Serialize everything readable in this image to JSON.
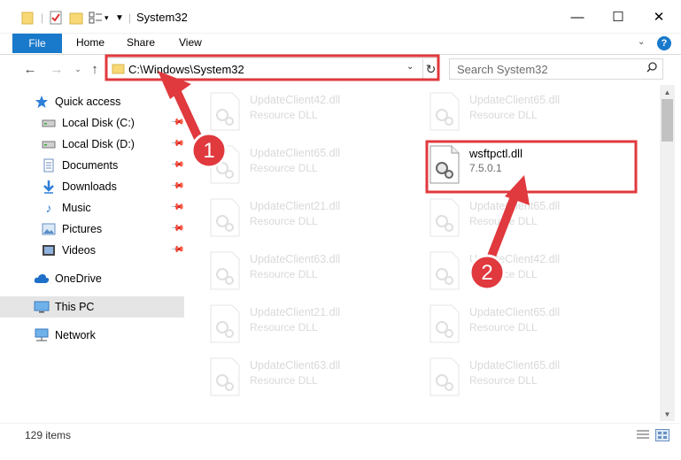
{
  "window": {
    "title": "System32",
    "minimize": "—",
    "maximize": "☐",
    "close": "✕"
  },
  "ribbon": {
    "file": "File",
    "home": "Home",
    "share": "Share",
    "view": "View",
    "help": "?"
  },
  "nav": {
    "address": "C:\\Windows\\System32",
    "search_placeholder": "Search System32"
  },
  "sidebar": {
    "items": [
      {
        "label": "Quick access",
        "icon": "star-icon"
      },
      {
        "label": "Local Disk (C:)",
        "icon": "drive-icon",
        "pinned": true
      },
      {
        "label": "Local Disk (D:)",
        "icon": "drive-icon",
        "pinned": true
      },
      {
        "label": "Documents",
        "icon": "documents-icon",
        "pinned": true
      },
      {
        "label": "Downloads",
        "icon": "download-icon",
        "pinned": true
      },
      {
        "label": "Music",
        "icon": "music-icon",
        "pinned": true
      },
      {
        "label": "Pictures",
        "icon": "pictures-icon",
        "pinned": true
      },
      {
        "label": "Videos",
        "icon": "videos-icon",
        "pinned": true
      },
      {
        "label": "OneDrive",
        "icon": "cloud-icon"
      },
      {
        "label": "This PC",
        "icon": "computer-icon",
        "selected": true
      },
      {
        "label": "Network",
        "icon": "network-icon"
      }
    ]
  },
  "files": [
    {
      "name": "UpdateClient42.dll",
      "desc": "Resource DLL"
    },
    {
      "name": "UpdateClient65.dll",
      "desc": "Resource DLL"
    },
    {
      "name": "UpdateClient65.dll",
      "desc": "Resource DLL"
    },
    {
      "name": "wsftpctl.dll",
      "desc": "7.5.0.1",
      "highlight": true
    },
    {
      "name": "UpdateClient21.dll",
      "desc": "Resource DLL"
    },
    {
      "name": "UpdateClient65.dll",
      "desc": "Resource DLL"
    },
    {
      "name": "UpdateClient63.dll",
      "desc": "Resource DLL"
    },
    {
      "name": "UpdateClient42.dll",
      "desc": "Resource DLL"
    },
    {
      "name": "UpdateClient21.dll",
      "desc": "Resource DLL"
    },
    {
      "name": "UpdateClient65.dll",
      "desc": "Resource DLL"
    },
    {
      "name": "UpdateClient63.dll",
      "desc": "Resource DLL"
    },
    {
      "name": "UpdateClient65.dll",
      "desc": "Resource DLL"
    }
  ],
  "status": {
    "item_count": "129 items"
  },
  "annotations": {
    "step1": "1",
    "step2": "2",
    "color": "#e0393e"
  }
}
